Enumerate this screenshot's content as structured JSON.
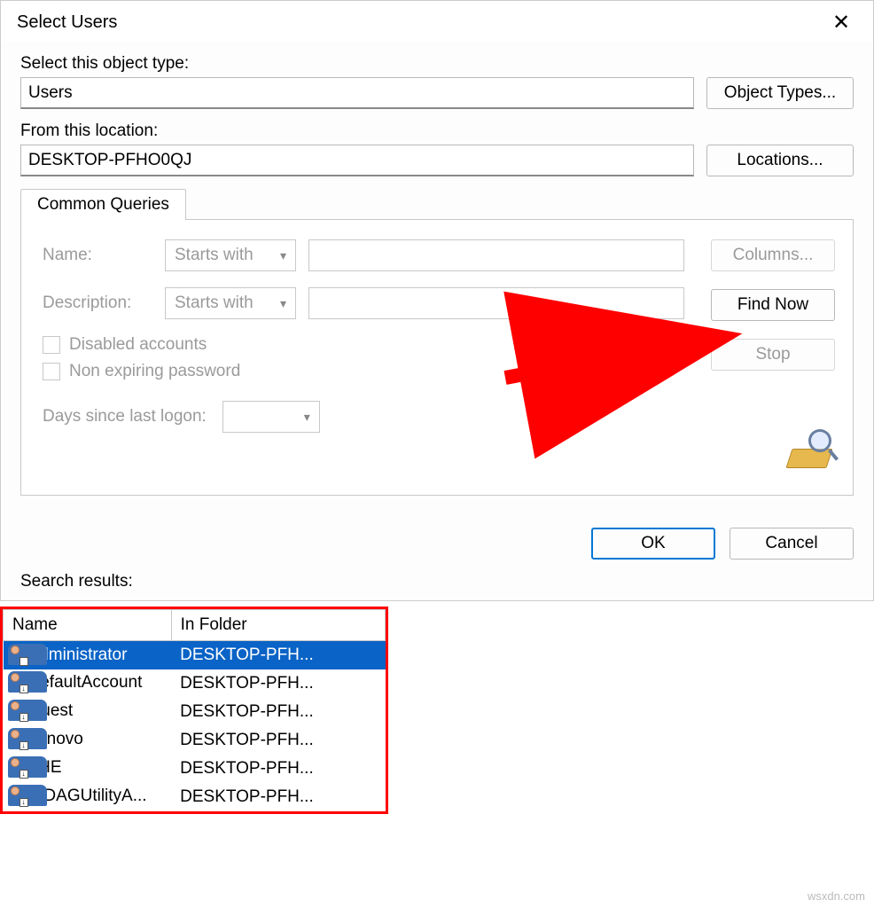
{
  "dialog": {
    "title": "Select Users",
    "close_glyph": "✕"
  },
  "object_type": {
    "label": "Select this object type:",
    "value": "Users",
    "button": "Object Types..."
  },
  "location": {
    "label": "From this location:",
    "value": "DESKTOP-PFHO0QJ",
    "button": "Locations..."
  },
  "queries": {
    "tab": "Common Queries",
    "name_label": "Name:",
    "name_op": "Starts with",
    "desc_label": "Description:",
    "desc_op": "Starts with",
    "disabled_accounts": "Disabled accounts",
    "non_expiring": "Non expiring password",
    "days_label": "Days since last logon:",
    "columns_button": "Columns...",
    "find_button": "Find Now",
    "stop_button": "Stop"
  },
  "footer": {
    "ok": "OK",
    "cancel": "Cancel",
    "search_results": "Search results:"
  },
  "results": {
    "headers": {
      "name": "Name",
      "folder": "In Folder"
    },
    "rows": [
      {
        "name": "Administrator",
        "folder": "DESKTOP-PFH...",
        "selected": true
      },
      {
        "name": "DefaultAccount",
        "folder": "DESKTOP-PFH...",
        "selected": false
      },
      {
        "name": "Guest",
        "folder": "DESKTOP-PFH...",
        "selected": false
      },
      {
        "name": "Lenovo",
        "folder": "DESKTOP-PFH...",
        "selected": false
      },
      {
        "name": "THE",
        "folder": "DESKTOP-PFH...",
        "selected": false
      },
      {
        "name": "WDAGUtilityA...",
        "folder": "DESKTOP-PFH...",
        "selected": false
      }
    ]
  },
  "watermark": "wsxdn.com"
}
